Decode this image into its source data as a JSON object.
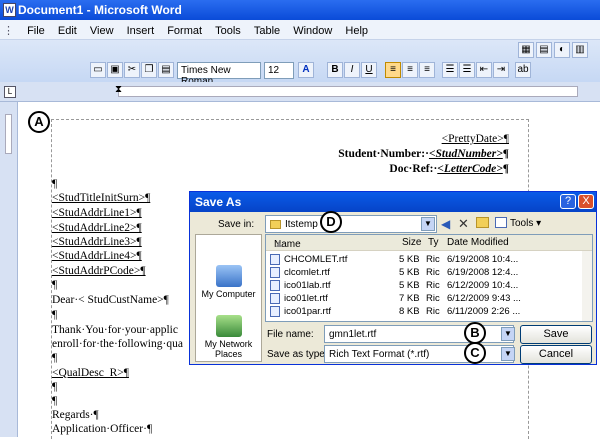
{
  "window": {
    "title": "Document1 - Microsoft Word",
    "icon": "word-doc-icon"
  },
  "menu": [
    "File",
    "Edit",
    "View",
    "Insert",
    "Format",
    "Tools",
    "Table",
    "Window",
    "Help"
  ],
  "toolbar": {
    "font_name": "Times New Roman",
    "font_size": "12",
    "bold": "B",
    "italic": "I",
    "underline": "U"
  },
  "markers": {
    "a": "A",
    "b": "B",
    "c": "C",
    "d": "D"
  },
  "document": {
    "pretty_date": "<PrettyDate>¶",
    "student_number_label": "Student·Number:·",
    "student_number_field": "<StudNumber>",
    "doc_ref_label": "Doc·Ref:·",
    "doc_ref_field": "<LetterCode>",
    "pilcrow": "¶",
    "lines": [
      "<StudTitleInitSurn>¶",
      "<StudAddrLine1>¶",
      "<StudAddrLine2>¶",
      "<StudAddrLine3>¶",
      "<StudAddrLine4>¶",
      "<StudAddrPCode>¶"
    ],
    "dear": "Dear·< StudCustName>¶",
    "thank_you": "Thank·You·for·your·applic",
    "enroll": "enroll·for·the·following·qua",
    "qual": "<QualDesc_R>¶",
    "regards": "Regards·¶",
    "officer": "Application·Officer·¶"
  },
  "dialog": {
    "title": "Save As",
    "save_in_label": "Save in:",
    "save_in_value": "Itstemp",
    "tools_label": "Tools",
    "columns": {
      "name": "Name",
      "size": "Size",
      "type": "Ty",
      "date": "Date Modified"
    },
    "files": [
      {
        "name": "CHCOMLET.rtf",
        "size": "5 KB",
        "type": "Ric",
        "date": "6/19/2008 10:4..."
      },
      {
        "name": "clcomlet.rtf",
        "size": "5 KB",
        "type": "Ric",
        "date": "6/19/2008 12:4..."
      },
      {
        "name": "ico01lab.rtf",
        "size": "5 KB",
        "type": "Ric",
        "date": "6/12/2009 10:4..."
      },
      {
        "name": "ico01let.rtf",
        "size": "7 KB",
        "type": "Ric",
        "date": "6/12/2009 9:43 ..."
      },
      {
        "name": "ico01par.rtf",
        "size": "8 KB",
        "type": "Ric",
        "date": "6/11/2009 2:26 ..."
      }
    ],
    "places": [
      "My Computer",
      "My Network Places"
    ],
    "file_name_label": "File name:",
    "file_name_value": "gmn1let.rtf",
    "save_type_label": "Save as type:",
    "save_type_value": "Rich Text Format (*.rtf)",
    "save_button": "Save",
    "cancel_button": "Cancel",
    "help_button": "?",
    "close_button": "X"
  }
}
